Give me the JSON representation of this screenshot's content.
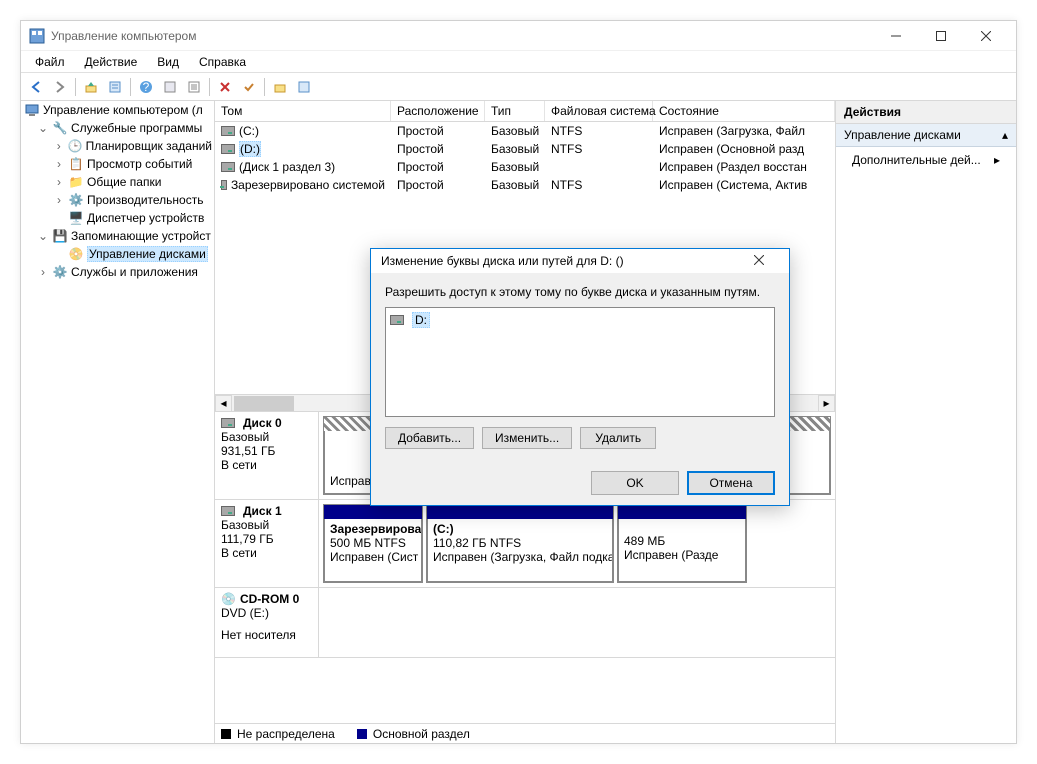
{
  "window": {
    "title": "Управление компьютером"
  },
  "menu": {
    "file": "Файл",
    "action": "Действие",
    "view": "Вид",
    "help": "Справка"
  },
  "tree": {
    "root": "Управление компьютером (л",
    "system_tools": "Служебные программы",
    "scheduler": "Планировщик заданий",
    "eventviewer": "Просмотр событий",
    "shared": "Общие папки",
    "perf": "Производительность",
    "devices": "Диспетчер устройств",
    "storage": "Запоминающие устройст",
    "diskmgmt": "Управление дисками",
    "services": "Службы и приложения"
  },
  "columns": {
    "tom": "Том",
    "layout": "Расположение",
    "type": "Тип",
    "fs": "Файловая система",
    "status": "Состояние"
  },
  "volumes": [
    {
      "name": "(C:)",
      "layout": "Простой",
      "type": "Базовый",
      "fs": "NTFS",
      "status": "Исправен (Загрузка, Файл"
    },
    {
      "name": "(D:)",
      "layout": "Простой",
      "type": "Базовый",
      "fs": "NTFS",
      "status": "Исправен (Основной разд"
    },
    {
      "name": "(Диск 1 раздел 3)",
      "layout": "Простой",
      "type": "Базовый",
      "fs": "",
      "status": "Исправен (Раздел восстан"
    },
    {
      "name": "Зарезервировано системой",
      "layout": "Простой",
      "type": "Базовый",
      "fs": "NTFS",
      "status": "Исправен (Система, Актив"
    }
  ],
  "disks": {
    "disk0": {
      "name": "Диск 0",
      "kind": "Базовый",
      "size": "931,51 ГБ",
      "net": "В сети",
      "p1_status": "Исправен (Основной раздел)"
    },
    "disk1": {
      "name": "Диск 1",
      "kind": "Базовый",
      "size": "111,79 ГБ",
      "net": "В сети",
      "p1_name": "Зарезервирова",
      "p1_sz": "500 МБ NTFS",
      "p1_st": "Исправен (Сист",
      "p2_name": "(C:)",
      "p2_sz": "110,82 ГБ NTFS",
      "p2_st": "Исправен (Загрузка, Файл подка",
      "p3_sz": "489 МБ",
      "p3_st": "Исправен (Разде"
    },
    "cdrom": {
      "name": "CD-ROM 0",
      "kind": "DVD (E:)",
      "nomedia": "Нет носителя"
    }
  },
  "legend": {
    "unalloc": "Не распределена",
    "primary": "Основной раздел"
  },
  "actions": {
    "header": "Действия",
    "group": "Управление дисками",
    "more": "Дополнительные дей..."
  },
  "dialog": {
    "title": "Изменение буквы диска или путей для D: ()",
    "text": "Разрешить доступ к этому тому по букве диска и указанным путям.",
    "item": "D:",
    "add": "Добавить...",
    "change": "Изменить...",
    "delete": "Удалить",
    "ok": "OK",
    "cancel": "Отмена"
  }
}
